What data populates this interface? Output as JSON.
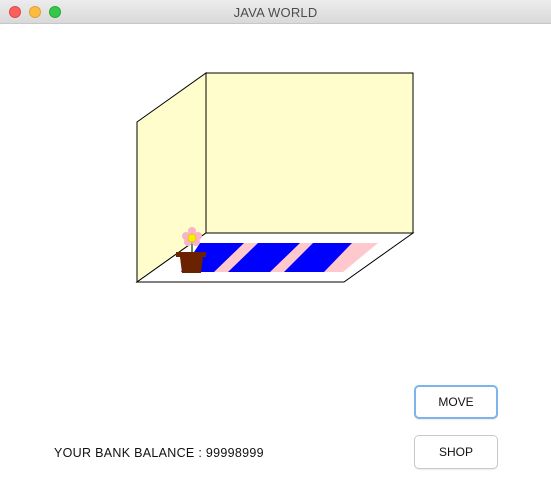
{
  "window": {
    "title": "JAVA WORLD"
  },
  "buttons": {
    "move_label": "MOVE",
    "shop_label": "SHOP"
  },
  "balance": {
    "label": "YOUR BANK BALANCE : ",
    "value": "99998999"
  },
  "colors": {
    "wall": "#fffdcc",
    "rug_stripe_a": "#0000ff",
    "rug_stripe_b": "#ffc8cd",
    "pot": "#6b2200",
    "flower_petal": "#f7b4c7",
    "flower_center": "#f5f000"
  },
  "icons": {
    "close": "close-light",
    "minimize": "minimize-light",
    "maximize": "maximize-light"
  }
}
